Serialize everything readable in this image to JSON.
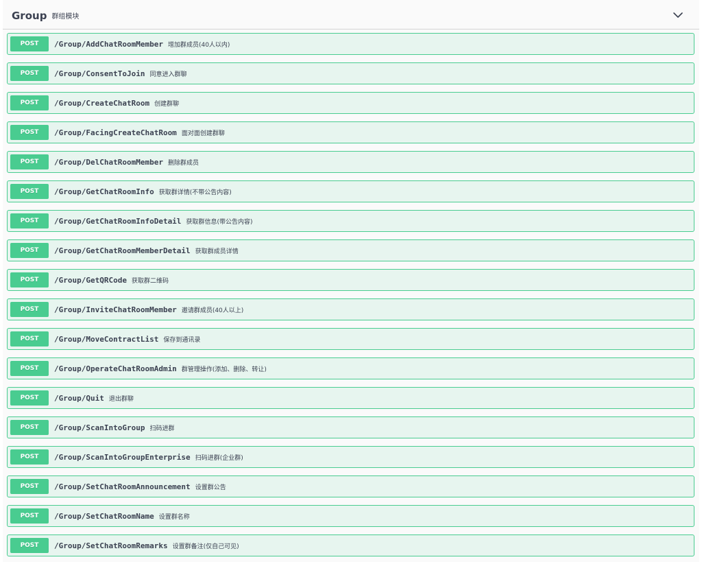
{
  "section": {
    "title": "Group",
    "description": "群组模块",
    "toggle_icon": "chevron-down-icon"
  },
  "colors": {
    "post_accent": "#49cc90",
    "post_background": "#ebf8f1",
    "text": "#3b4151"
  },
  "operations": [
    {
      "method": "POST",
      "path": "/Group/AddChatRoomMember",
      "summary": "增加群成员(40人以内)"
    },
    {
      "method": "POST",
      "path": "/Group/ConsentToJoin",
      "summary": "同意进入群聊"
    },
    {
      "method": "POST",
      "path": "/Group/CreateChatRoom",
      "summary": "创建群聊"
    },
    {
      "method": "POST",
      "path": "/Group/FacingCreateChatRoom",
      "summary": "面对面创建群聊"
    },
    {
      "method": "POST",
      "path": "/Group/DelChatRoomMember",
      "summary": "删除群成员"
    },
    {
      "method": "POST",
      "path": "/Group/GetChatRoomInfo",
      "summary": "获取群详情(不带公告内容)"
    },
    {
      "method": "POST",
      "path": "/Group/GetChatRoomInfoDetail",
      "summary": "获取群信息(带公告内容)"
    },
    {
      "method": "POST",
      "path": "/Group/GetChatRoomMemberDetail",
      "summary": "获取群成员详情"
    },
    {
      "method": "POST",
      "path": "/Group/GetQRCode",
      "summary": "获取群二维码"
    },
    {
      "method": "POST",
      "path": "/Group/InviteChatRoomMember",
      "summary": "邀请群成员(40人以上)"
    },
    {
      "method": "POST",
      "path": "/Group/MoveContractList",
      "summary": "保存到通讯录"
    },
    {
      "method": "POST",
      "path": "/Group/OperateChatRoomAdmin",
      "summary": "群管理操作(添加、删除、转让)"
    },
    {
      "method": "POST",
      "path": "/Group/Quit",
      "summary": "退出群聊"
    },
    {
      "method": "POST",
      "path": "/Group/ScanIntoGroup",
      "summary": "扫码进群"
    },
    {
      "method": "POST",
      "path": "/Group/ScanIntoGroupEnterprise",
      "summary": "扫码进群(企业群)"
    },
    {
      "method": "POST",
      "path": "/Group/SetChatRoomAnnouncement",
      "summary": "设置群公告"
    },
    {
      "method": "POST",
      "path": "/Group/SetChatRoomName",
      "summary": "设置群名称"
    },
    {
      "method": "POST",
      "path": "/Group/SetChatRoomRemarks",
      "summary": "设置群备注(仅自己可见)"
    }
  ]
}
